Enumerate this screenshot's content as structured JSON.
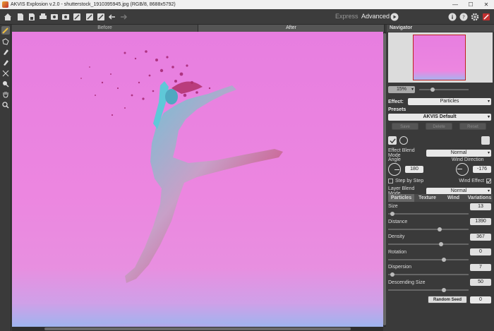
{
  "window": {
    "title": "AKVIS Explosion v.2.0 - shutterstock_1910395945.jpg (RGB/8, 8688x5792)",
    "minimize": "—",
    "maximize": "☐",
    "close": "✕"
  },
  "toolbar": {
    "express": "Express",
    "advanced": "Advanced"
  },
  "view_tabs": {
    "before": "Before",
    "after": "After"
  },
  "navigator": {
    "title": "Navigator",
    "zoom": "15%"
  },
  "effect": {
    "label": "Effect:",
    "value": "Particles"
  },
  "presets": {
    "label": "Presets",
    "value": "AKVIS Default",
    "save": "Save",
    "delete": "Delete",
    "reset": "Reset"
  },
  "blend": {
    "effect_label": "Effect Blend Mode",
    "effect_value": "Normal",
    "layer_label": "Layer Blend Mode",
    "layer_value": "Normal"
  },
  "angle": {
    "label": "Angle",
    "value": "180"
  },
  "wind_direction": {
    "label": "Wind Direction",
    "value": "-176"
  },
  "step_by_step": {
    "label": "Step by Step",
    "checked": false
  },
  "wind_effect": {
    "label": "Wind Effect",
    "checked": true
  },
  "param_tabs": [
    "Particles",
    "Texture",
    "Wind",
    "Variations"
  ],
  "params": [
    {
      "label": "Size",
      "value": "13",
      "fraction": 0.03
    },
    {
      "label": "Distance",
      "value": "1390",
      "fraction": 0.65
    },
    {
      "label": "Density",
      "value": "367",
      "fraction": 0.67
    },
    {
      "label": "Rotation",
      "value": "0",
      "fraction": 0.7
    },
    {
      "label": "Dispersion",
      "value": "7",
      "fraction": 0.03
    },
    {
      "label": "Descending Size",
      "value": "50",
      "fraction": 0.7
    }
  ],
  "random_seed": {
    "label": "Random Seed",
    "value": "0"
  }
}
